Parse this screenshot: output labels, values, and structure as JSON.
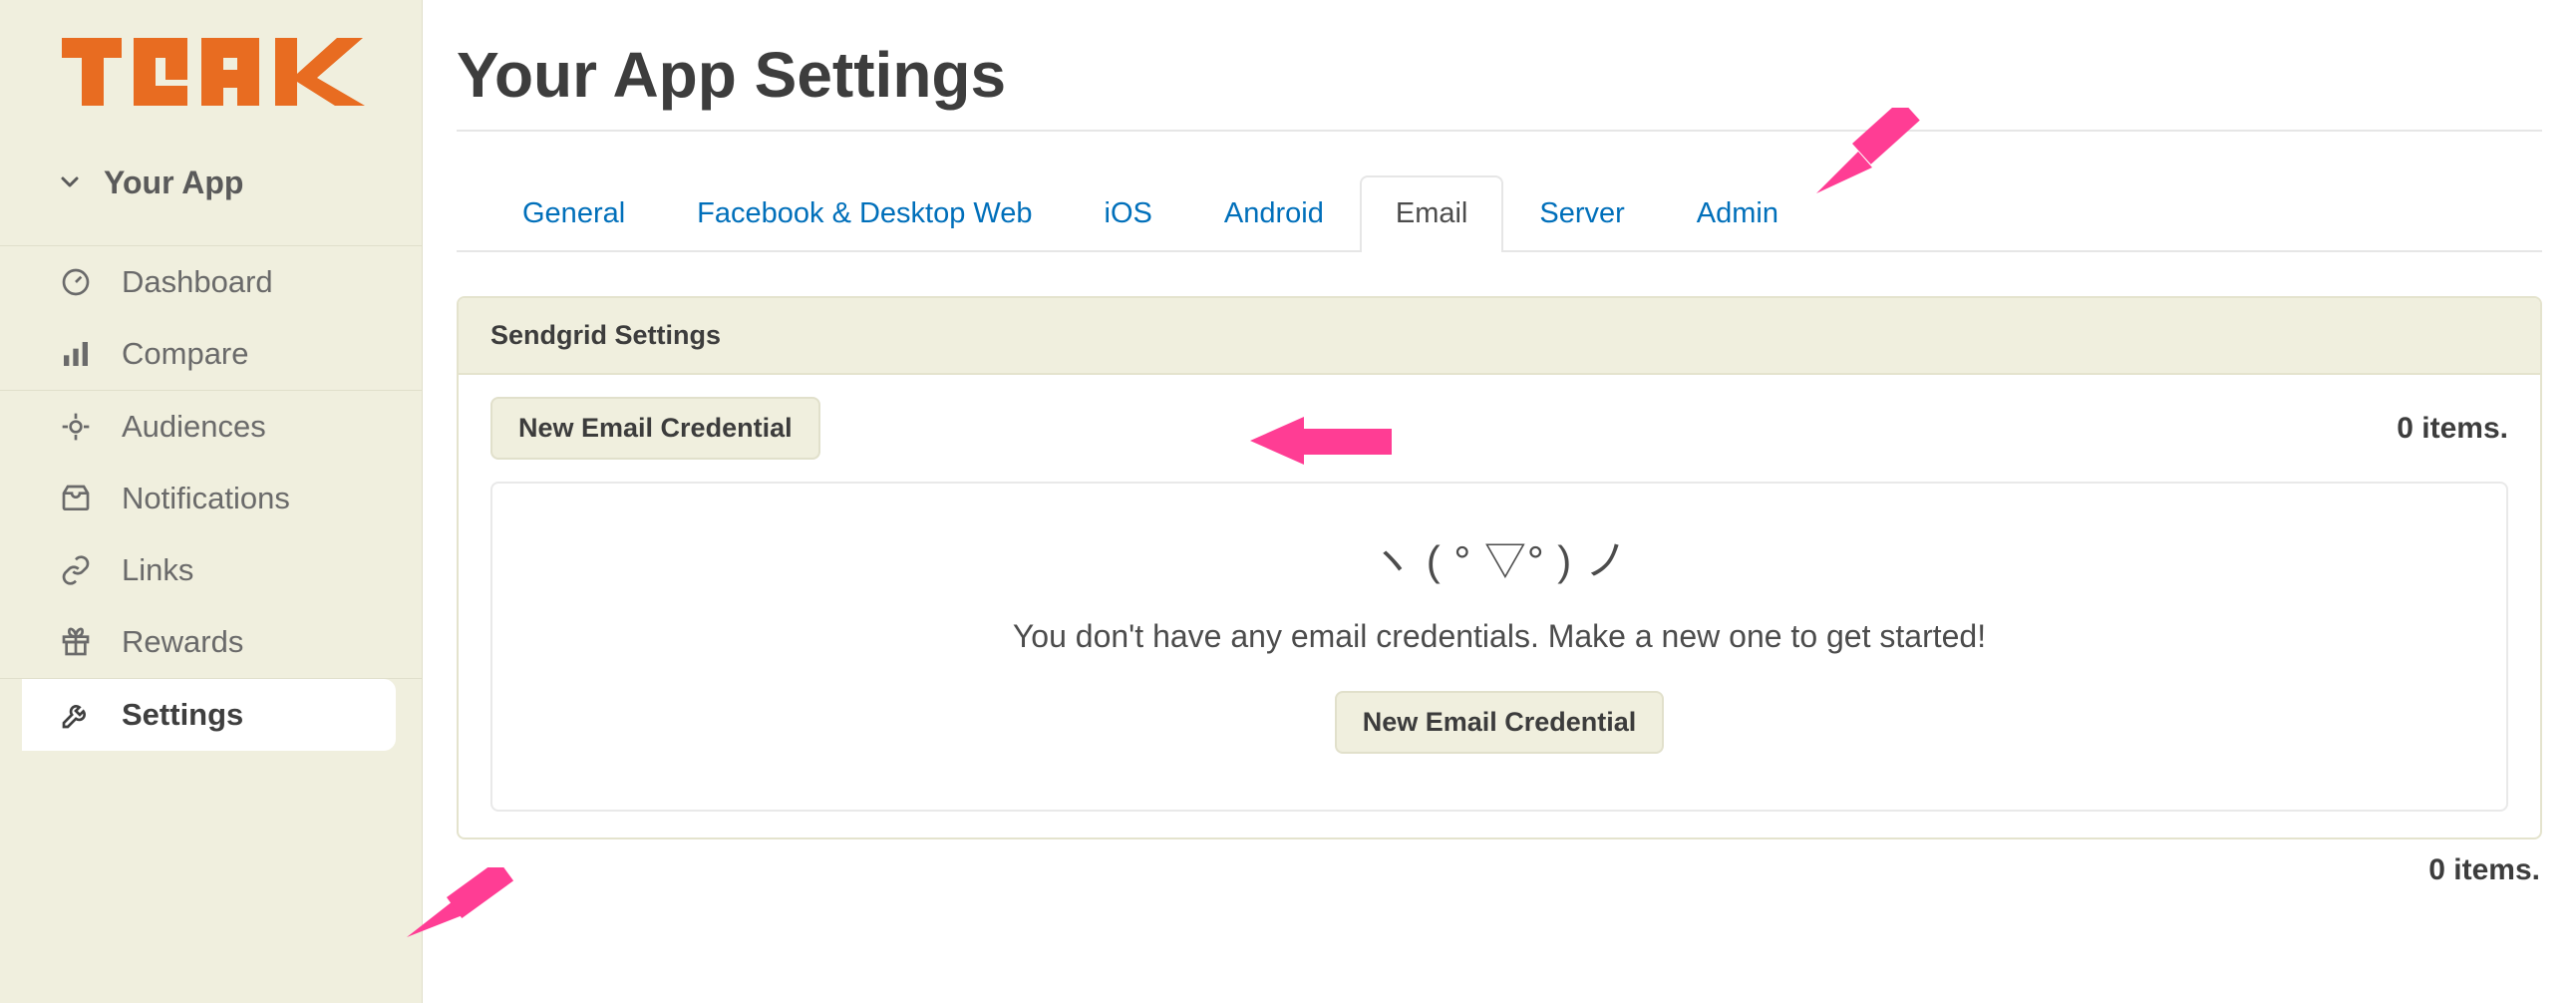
{
  "sidebar": {
    "app_name": "Your App",
    "items": [
      {
        "label": "Dashboard"
      },
      {
        "label": "Compare"
      },
      {
        "label": "Audiences"
      },
      {
        "label": "Notifications"
      },
      {
        "label": "Links"
      },
      {
        "label": "Rewards"
      },
      {
        "label": "Settings"
      }
    ]
  },
  "header": {
    "title": "Your App Settings"
  },
  "tabs": [
    {
      "label": "General"
    },
    {
      "label": "Facebook & Desktop Web"
    },
    {
      "label": "iOS"
    },
    {
      "label": "Android"
    },
    {
      "label": "Email",
      "active": true
    },
    {
      "label": "Server"
    },
    {
      "label": "Admin"
    }
  ],
  "panel": {
    "title": "Sendgrid Settings",
    "new_button": "New Email Credential",
    "count_top": "0 items.",
    "empty_face": "ヽ ( ° ▽° ) ノ",
    "empty_message": "You don't have any email credentials. Make a new one to get started!",
    "empty_button": "New Email Credential",
    "count_bottom": "0 items."
  }
}
